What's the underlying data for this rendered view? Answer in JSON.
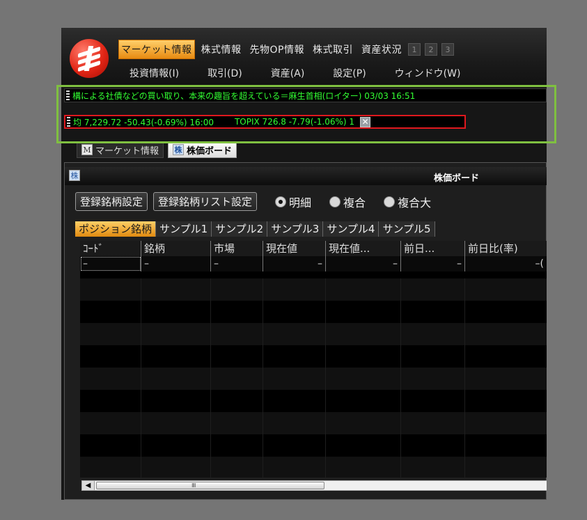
{
  "menu": {
    "tabs": [
      "マーケット情報",
      "株式情報",
      "先物OP情報",
      "株式取引",
      "資産状況"
    ],
    "window_buttons": [
      "1",
      "2",
      "3"
    ],
    "items": [
      "投資情報(I)",
      "取引(D)",
      "資産(A)",
      "設定(P)",
      "ウィンドウ(W)"
    ]
  },
  "ticker1": {
    "text": "構による社債などの買い取り、本来の趣旨を超えている＝麻生首相(ロイター) 03/03 16:51 "
  },
  "ticker2": {
    "nikkei": "均 7,229.72  -50.43(-0.69%)  16:00",
    "topix": "TOPIX 726.8  -7.79(-1.06%)  1",
    "close_label": "✕"
  },
  "window_tabs": [
    {
      "badge": "M",
      "label": "マーケット情報"
    },
    {
      "badge": "株",
      "label": "株価ボード"
    }
  ],
  "board": {
    "icon": "株",
    "title": "株価ボード",
    "buttons": [
      "登録銘柄設定",
      "登録銘柄リスト設定"
    ],
    "radios": [
      {
        "label": "明細",
        "checked": true
      },
      {
        "label": "複合",
        "checked": false
      },
      {
        "label": "複合大",
        "checked": false
      }
    ],
    "subtabs": [
      "ポジション銘柄",
      "サンプル1",
      "サンプル2",
      "サンプル3",
      "サンプル4",
      "サンプル5"
    ],
    "columns": [
      "ｺｰﾄﾞ",
      "銘柄",
      "市場",
      "現在値",
      "現在値...",
      "前日...",
      "前日比(率)"
    ],
    "first_row": [
      "–",
      "–",
      "–",
      "–",
      "–",
      "–",
      "–("
    ],
    "scroll_grip": "IIII"
  },
  "colors": {
    "accent_orange": "#f0a030",
    "ticker_green": "#33ff33",
    "highlight_green": "#7fc040",
    "ticker_border_red": "#e0181e"
  }
}
